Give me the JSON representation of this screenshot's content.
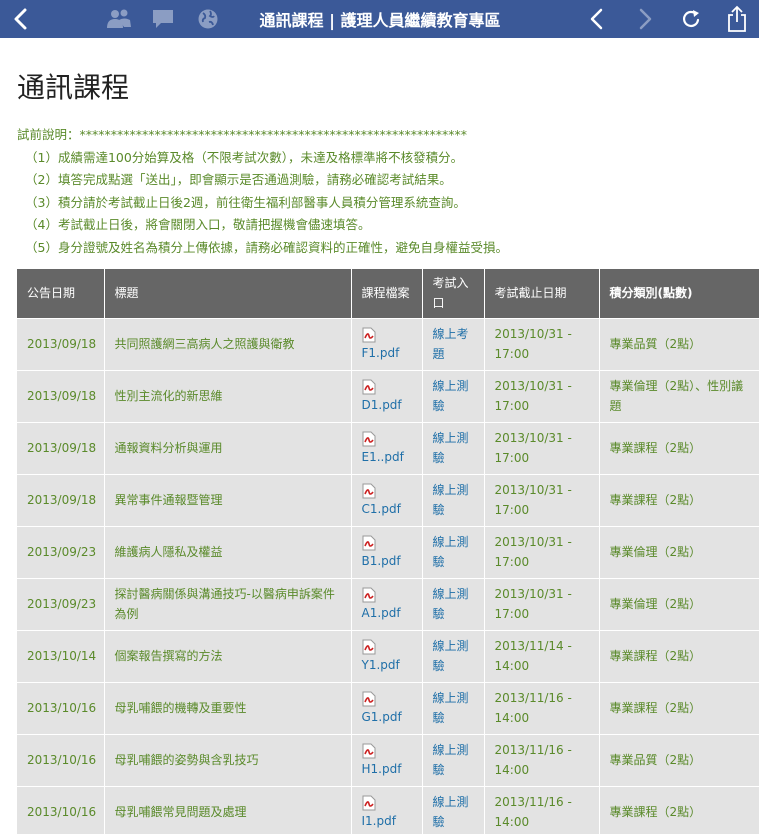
{
  "nav": {
    "title": "通訊課程 | 護理人員繼續教育專區",
    "icons": [
      "back-chevron-icon",
      "people-icon",
      "message-icon",
      "globe-icon",
      "browser-back-icon",
      "browser-forward-icon",
      "reload-icon",
      "share-icon"
    ],
    "colors": {
      "bar": "#3b5998",
      "icon": "#ffffff",
      "muted_icon": "#8b9dc3"
    }
  },
  "page": {
    "title": "通訊課程"
  },
  "notes": {
    "heading": "試前說明：**************************************************************",
    "lines": [
      "（1）成績需達100分始算及格（不限考試次數），未達及格標準將不核發積分。",
      "（2）填答完成點選「送出」，即會顯示是否通過測驗，請務必確認考試結果。",
      "（3）積分請於考試截止日後2週，前往衛生福利部醫事人員積分管理系統查詢。",
      "（4）考試截止日後，將會關閉入口，敬請把握機會儘速填答。",
      "（5）身分證號及姓名為積分上傳依據，請務必確認資料的正確性，避免自身權益受損。"
    ],
    "color": "#5a8a2a"
  },
  "table": {
    "headers": [
      "公告日期",
      "標題",
      "課程檔案",
      "考試入口",
      "考試截止日期",
      "積分類別(點數)"
    ],
    "rows": [
      {
        "date": "2013/09/18",
        "title": "共同照護網三高病人之照護與衛教",
        "pdf": "F1.pdf",
        "entry": "線上考題",
        "deadline": "2013/10/31 - 17:00",
        "credit": "專業品質（2點）"
      },
      {
        "date": "2013/09/18",
        "title": "性別主流化的新思維",
        "pdf": "D1.pdf",
        "entry": "線上測驗",
        "deadline": "2013/10/31 - 17:00",
        "credit": "專業倫理（2點）、性別議題"
      },
      {
        "date": "2013/09/18",
        "title": "通報資料分析與運用",
        "pdf": "E1..pdf",
        "entry": "線上測驗",
        "deadline": "2013/10/31 - 17:00",
        "credit": "專業課程（2點）"
      },
      {
        "date": "2013/09/18",
        "title": "異常事件通報暨管理",
        "pdf": "C1.pdf",
        "entry": "線上測驗",
        "deadline": "2013/10/31 - 17:00",
        "credit": "專業課程（2點）"
      },
      {
        "date": "2013/09/23",
        "title": "維護病人隱私及權益",
        "pdf": "B1.pdf",
        "entry": "線上測驗",
        "deadline": "2013/10/31 - 17:00",
        "credit": "專業倫理（2點）"
      },
      {
        "date": "2013/09/23",
        "title": "探討醫病關係與溝通技巧-以醫病申訴案件為例",
        "pdf": "A1.pdf",
        "entry": "線上測驗",
        "deadline": "2013/10/31 - 17:00",
        "credit": "專業倫理（2點）"
      },
      {
        "date": "2013/10/14",
        "title": "個案報告撰寫的方法",
        "pdf": "Y1.pdf",
        "entry": "線上測驗",
        "deadline": "2013/11/14 - 14:00",
        "credit": "專業課程（2點）"
      },
      {
        "date": "2013/10/16",
        "title": "母乳哺餵的機轉及重要性",
        "pdf": "G1.pdf",
        "entry": "線上測驗",
        "deadline": "2013/11/16 - 14:00",
        "credit": "專業課程（2點）"
      },
      {
        "date": "2013/10/16",
        "title": "母乳哺餵的姿勢與含乳技巧",
        "pdf": "H1.pdf",
        "entry": "線上測驗",
        "deadline": "2013/11/16 - 14:00",
        "credit": "專業品質（2點）"
      },
      {
        "date": "2013/10/16",
        "title": "母乳哺餵常見問題及處理",
        "pdf": "I1.pdf",
        "entry": "線上測驗",
        "deadline": "2013/11/16 - 14:00",
        "credit": "專業課程（2點）"
      }
    ],
    "colors": {
      "header_bg": "#666666",
      "row_bg": "#e3e3e3",
      "text": "#5a8a2a",
      "link": "#1f6fa8",
      "pdf_icon": "#cc2222"
    }
  }
}
